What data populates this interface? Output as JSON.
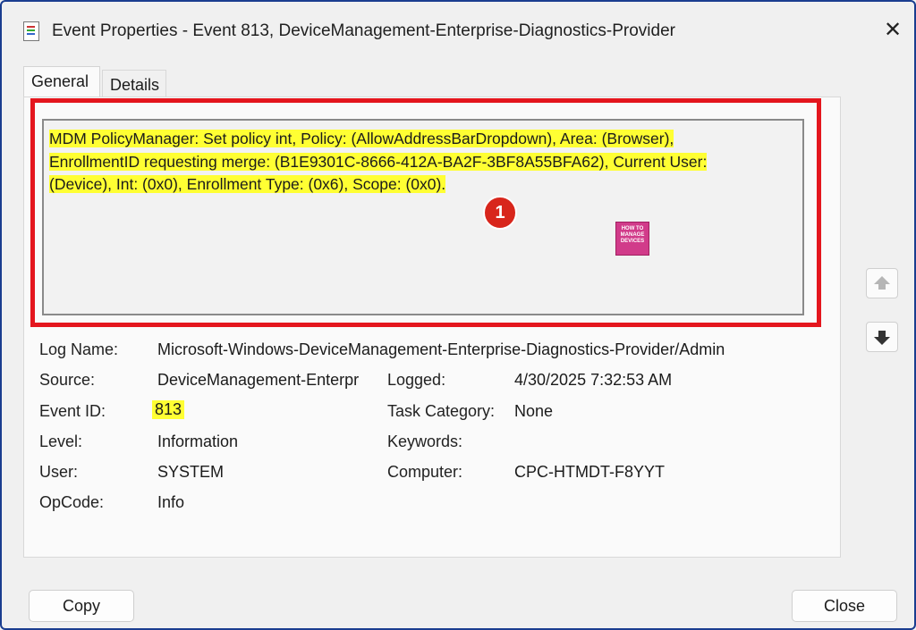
{
  "window": {
    "title": "Event Properties - Event 813, DeviceManagement-Enterprise-Diagnostics-Provider"
  },
  "tabs": [
    {
      "label": "General"
    },
    {
      "label": "Details"
    }
  ],
  "description": {
    "line1": "MDM PolicyManager: Set policy int, Policy: (AllowAddressBarDropdown), Area: (Browser),",
    "line2": "EnrollmentID requesting merge: (B1E9301C-8666-412A-BA2F-3BF8A55BFA62), Current User:",
    "line3": "(Device), Int: (0x0), Enrollment Type: (0x6), Scope: (0x0)."
  },
  "annotation": {
    "badge": "1"
  },
  "logo": {
    "line1": "HOW TO",
    "line2": "MANAGE",
    "line3": "DEVICES"
  },
  "fields": {
    "log_name": {
      "label": "Log Name:",
      "value": "Microsoft-Windows-DeviceManagement-Enterprise-Diagnostics-Provider/Admin"
    },
    "source": {
      "label": "Source:",
      "value": "DeviceManagement-Enterpr"
    },
    "logged": {
      "label": "Logged:",
      "value": "4/30/2025 7:32:53 AM"
    },
    "event_id": {
      "label": "Event ID:",
      "value": "813"
    },
    "task_category": {
      "label": "Task Category:",
      "value": "None"
    },
    "level": {
      "label": "Level:",
      "value": "Information"
    },
    "keywords": {
      "label": "Keywords:",
      "value": ""
    },
    "user": {
      "label": "User:",
      "value": "SYSTEM"
    },
    "computer": {
      "label": "Computer:",
      "value": "CPC-HTMDT-F8YYT"
    },
    "opcode": {
      "label": "OpCode:",
      "value": "Info"
    }
  },
  "buttons": {
    "copy": "Copy",
    "close": "Close"
  },
  "colors": {
    "highlight": "#ffff33",
    "annotation_frame": "#e4161e",
    "badge": "#d8261c"
  },
  "icons": {
    "app": "event-viewer-icon",
    "close": "close-icon",
    "up": "arrow-up-icon",
    "down": "arrow-down-icon"
  }
}
